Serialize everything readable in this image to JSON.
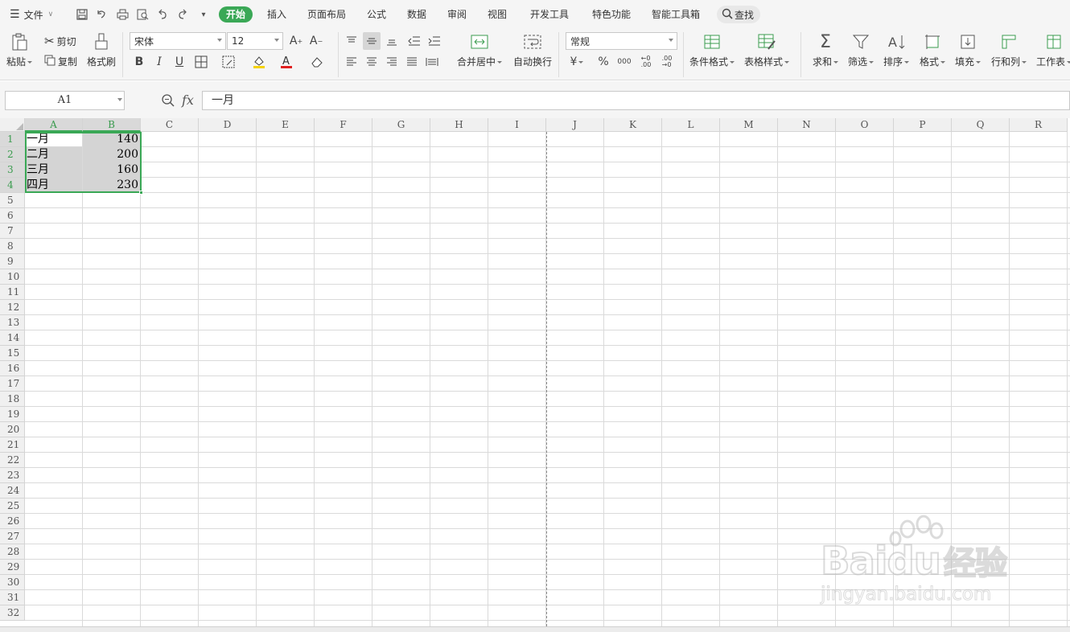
{
  "menubar": {
    "file_label": "文件",
    "tabs": [
      "开始",
      "插入",
      "页面布局",
      "公式",
      "数据",
      "审阅",
      "视图",
      "开发工具",
      "特色功能",
      "智能工具箱"
    ],
    "active_tab": "开始",
    "find_label": "查找"
  },
  "ribbon": {
    "paste": "粘贴",
    "cut": "剪切",
    "copy": "复制",
    "format_painter": "格式刷",
    "font_name": "宋体",
    "font_size": "12",
    "merge_center": "合并居中",
    "wrap_text": "自动换行",
    "number_format": "常规",
    "currency": "¥",
    "percent": "%",
    "thousands": "000",
    "conditional_format": "条件格式",
    "table_style": "表格样式",
    "sum": "求和",
    "filter": "筛选",
    "sort": "排序",
    "format": "格式",
    "fill": "填充",
    "row_col": "行和列",
    "worksheet": "工作表"
  },
  "formula_bar": {
    "name_box": "A1",
    "fx": "fx",
    "content": "一月"
  },
  "sheet": {
    "columns": [
      "A",
      "B",
      "C",
      "D",
      "E",
      "F",
      "G",
      "H",
      "I",
      "J",
      "K",
      "L",
      "M",
      "N",
      "O",
      "P",
      "Q",
      "R"
    ],
    "rows": [
      "1",
      "2",
      "3",
      "4",
      "5",
      "6",
      "7",
      "8",
      "9",
      "10",
      "11",
      "12",
      "13",
      "14",
      "15",
      "16",
      "17",
      "18",
      "19",
      "20",
      "21",
      "22",
      "23",
      "24",
      "25",
      "26",
      "27",
      "28",
      "29",
      "30",
      "31",
      "32"
    ],
    "data": [
      {
        "a": "一月",
        "b": "140"
      },
      {
        "a": "二月",
        "b": "200"
      },
      {
        "a": "三月",
        "b": "160"
      },
      {
        "a": "四月",
        "b": "230"
      }
    ],
    "selected_range": "A1:B4"
  },
  "watermark": {
    "brand": "Bai",
    "brand2": "du",
    "cn": "经验",
    "url": "jingyan.baidu.com"
  }
}
